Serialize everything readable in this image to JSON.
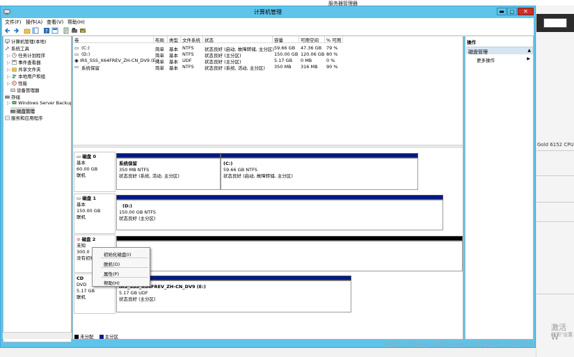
{
  "background": {
    "server_manager_title": "服务器管理器",
    "cpu_text": "Gold 6152 CPU",
    "activate_title": "激活 W",
    "activate_sub": "转到\"设置"
  },
  "window": {
    "title": "计算机管理",
    "controls": {
      "minimize": "▬",
      "maximize": "▢",
      "close": "✕"
    }
  },
  "menu": [
    "文件(F)",
    "操作(A)",
    "查看(V)",
    "帮助(H)"
  ],
  "tree": {
    "root": "计算机管理(本地)",
    "items": [
      {
        "label": "系统工具",
        "level": 0
      },
      {
        "label": "任务计划程序",
        "level": 1
      },
      {
        "label": "事件查看器",
        "level": 1
      },
      {
        "label": "共享文件夹",
        "level": 1
      },
      {
        "label": "本地用户和组",
        "level": 1
      },
      {
        "label": "性能",
        "level": 1
      },
      {
        "label": "设备管理器",
        "level": 1
      },
      {
        "label": "存储",
        "level": 0
      },
      {
        "label": "Windows Server Backup",
        "level": 1
      },
      {
        "label": "磁盘管理",
        "level": 1
      },
      {
        "label": "服务和应用程序",
        "level": 0
      }
    ]
  },
  "volume_table": {
    "headers": [
      "卷",
      "布局",
      "类型",
      "文件系统",
      "状态",
      "容量",
      "可用空间",
      "% 可用"
    ],
    "rows": [
      [
        "(C:)",
        "简单",
        "基本",
        "NTFS",
        "状态良好 (启动, 故障转储, 主分区)",
        "59.66 GB",
        "47.36 GB",
        "79 %"
      ],
      [
        "(D:)",
        "简单",
        "基本",
        "NTFS",
        "状态良好 (主分区)",
        "150.00 GB",
        "120.06 GB",
        "80 %"
      ],
      [
        "IRS_SSS_X64FREV_ZH-CN_DV9 (E:)",
        "简单",
        "基本",
        "UDF",
        "状态良好 (主分区)",
        "5.17 GB",
        "0 MB",
        "0 %"
      ],
      [
        "系统保留",
        "简单",
        "基本",
        "NTFS",
        "状态良好 (系统, 活动, 主分区)",
        "350 MB",
        "316 MB",
        "90 %"
      ]
    ]
  },
  "disks": [
    {
      "name": "磁盘 0",
      "type": "基本",
      "size": "60.00 GB",
      "status": "联机",
      "partitions": [
        {
          "name": "系统保留",
          "detail": "350 MB NTFS",
          "status": "状态良好 (系统, 活动, 主分区)"
        },
        {
          "name": "(C:)",
          "detail": "59.66 GB NTFS",
          "status": "状态良好 (启动, 故障转储, 主分区)"
        }
      ]
    },
    {
      "name": "磁盘 1",
      "type": "基本",
      "size": "150.00 GB",
      "status": "联机",
      "partitions": [
        {
          "name": "(D:)",
          "detail": "150.00 GB NTFS",
          "status": "状态良好 (主分区)"
        }
      ]
    },
    {
      "name": "磁盘 2",
      "type": "未知",
      "size": "300.0",
      "status": "没有初始"
    },
    {
      "name": "CD",
      "type": "DVD",
      "size": "5.17 GB",
      "status": "联机",
      "partitions": [
        {
          "name": "IRS_SSS_X64FREV_ZH-CN_DV9 (E:)",
          "detail": "5.17 GB UDF",
          "status": "状态良好 (主分区)"
        }
      ]
    }
  ],
  "context_menu": [
    "初始化磁盘(I)",
    "脱机(O)",
    "属性(P)",
    "帮助(H)"
  ],
  "legend": {
    "unallocated": "未分配",
    "primary": "主分区"
  },
  "actions": {
    "header": "操作",
    "section": "磁盘管理",
    "item": "更多操作"
  },
  "watermark": "https://blog.csdn.net/czq19931587039",
  "colors": {
    "window_frame": "#5fc3ea",
    "partition_bar": "#001f8f",
    "unallocated_bar": "#000000",
    "close_button": "#c9302c"
  }
}
